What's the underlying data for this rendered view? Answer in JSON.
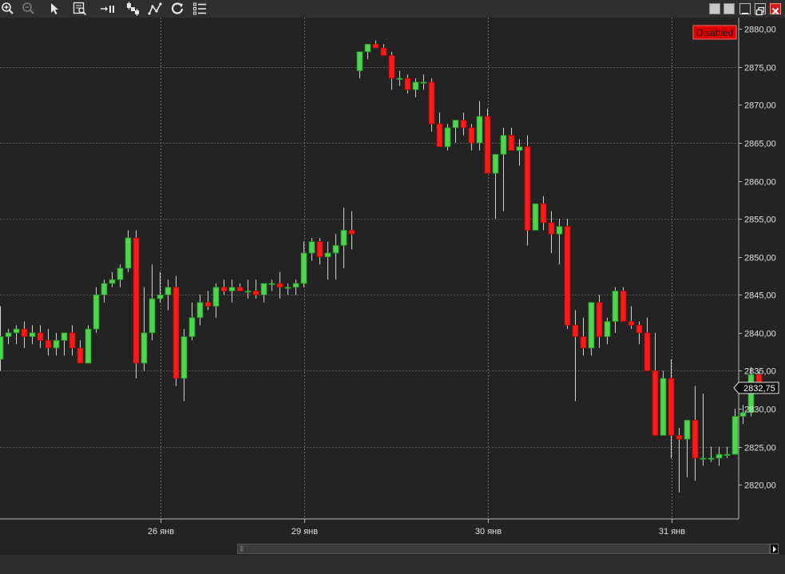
{
  "toolbar": {
    "tools": [
      {
        "name": "zoom-in-icon"
      },
      {
        "name": "zoom-out-icon"
      },
      {
        "name": "cursor-arrow-icon"
      },
      {
        "name": "magnify-data-box-icon"
      },
      {
        "name": "bar-spacing-icon"
      },
      {
        "name": "chart-type-icon"
      },
      {
        "name": "drawing-tools-icon"
      },
      {
        "name": "refresh-icon"
      },
      {
        "name": "list-icon"
      }
    ],
    "window_buttons": [
      "tile-button",
      "tile-button-2",
      "minimize-button",
      "restore-button",
      "close-button"
    ]
  },
  "status_badge": "Disabled",
  "current_price_label": "2832,75",
  "colors": {
    "background": "#232323",
    "up": "#2fb62f",
    "up_fill": "#4ed64e",
    "down": "#ff1a1a",
    "wick": "#d0d0d0",
    "grid": "#5a5a5a",
    "badge": "#e00000"
  },
  "chart_data": {
    "type": "candlestick",
    "y_ticks": [
      "2880,00",
      "2875,00",
      "2870,00",
      "2865,00",
      "2860,00",
      "2855,00",
      "2850,00",
      "2845,00",
      "2840,00",
      "2835,00",
      "2830,00",
      "2825,00",
      "2820,00"
    ],
    "ylim": [
      2815.5,
      2881.5
    ],
    "x_labels": [
      {
        "label": "26 янв",
        "index": 20.2
      },
      {
        "label": "29 янв",
        "index": 38.2
      },
      {
        "label": "30 янв",
        "index": 61.2
      },
      {
        "label": "31 янв",
        "index": 84.2
      }
    ],
    "session_breaks": [
      20.1,
      38.1,
      61.1,
      84.1
    ],
    "current_price": 2832.75,
    "candles": [
      [
        2836.5,
        2843.5,
        2835,
        2839.5
      ],
      [
        2839.5,
        2840.5,
        2838.5,
        2840
      ],
      [
        2840,
        2841,
        2838.5,
        2840.5
      ],
      [
        2840.5,
        2841.5,
        2838,
        2839.5
      ],
      [
        2839.5,
        2841,
        2838.5,
        2840
      ],
      [
        2840,
        2841,
        2838,
        2839
      ],
      [
        2839,
        2840.5,
        2837,
        2838
      ],
      [
        2838,
        2840,
        2837,
        2839
      ],
      [
        2839,
        2840,
        2837,
        2840
      ],
      [
        2840,
        2841,
        2837,
        2838
      ],
      [
        2838,
        2839,
        2836,
        2836
      ],
      [
        2836,
        2841,
        2836,
        2840.5
      ],
      [
        2840.5,
        2846,
        2840,
        2845
      ],
      [
        2845,
        2847,
        2844,
        2846.5
      ],
      [
        2846.5,
        2848,
        2846,
        2847
      ],
      [
        2847,
        2849,
        2846,
        2848.5
      ],
      [
        2848.5,
        2853.5,
        2848,
        2852.5
      ],
      [
        2852.5,
        2853.5,
        2834,
        2836
      ],
      [
        2836,
        2846,
        2835,
        2840
      ],
      [
        2840,
        2849,
        2839,
        2844.5
      ],
      [
        2844.5,
        2848,
        2844,
        2845
      ],
      [
        2845,
        2847,
        2843,
        2846
      ],
      [
        2846,
        2847.5,
        2833,
        2834
      ],
      [
        2834,
        2840.5,
        2831,
        2839.5
      ],
      [
        2839.5,
        2844,
        2839,
        2842
      ],
      [
        2842,
        2845,
        2841,
        2844
      ],
      [
        2844,
        2845.5,
        2843,
        2843.5
      ],
      [
        2843.5,
        2846.5,
        2842,
        2846
      ],
      [
        2846,
        2847,
        2845,
        2845.5
      ],
      [
        2845.5,
        2847,
        2844,
        2846
      ],
      [
        2846,
        2846.5,
        2845.5,
        2845.5
      ],
      [
        2845.5,
        2847,
        2844.5,
        2845.5
      ],
      [
        2845.5,
        2847,
        2844.5,
        2845
      ],
      [
        2845,
        2846.5,
        2844,
        2846.5
      ],
      [
        2846.5,
        2847,
        2845.5,
        2846.5
      ],
      [
        2846.5,
        2848,
        2844.5,
        2846
      ],
      [
        2846,
        2846.5,
        2845,
        2846
      ],
      [
        2846,
        2847,
        2845,
        2846.5
      ],
      [
        2846.5,
        2852,
        2846,
        2850.5
      ],
      [
        2850.5,
        2852.5,
        2849.5,
        2852
      ],
      [
        2852,
        2852.5,
        2849,
        2850
      ],
      [
        2850,
        2852,
        2847,
        2850.5
      ],
      [
        2850.5,
        2853,
        2847,
        2851.5
      ],
      [
        2851.5,
        2856.5,
        2848.5,
        2853.5
      ],
      [
        2853.5,
        2856,
        2851,
        2853
      ],
      [
        2874.5,
        2877,
        2873.5,
        2877
      ],
      [
        2877,
        2878,
        2876,
        2878
      ],
      [
        2878,
        2878.5,
        2877.5,
        2877.5
      ],
      [
        2877.5,
        2878,
        2876.5,
        2876.5
      ],
      [
        2876.5,
        2877,
        2872,
        2873.5
      ],
      [
        2873.5,
        2874.5,
        2872.5,
        2873.5
      ],
      [
        2873.5,
        2874,
        2871.5,
        2872
      ],
      [
        2872,
        2873.5,
        2871,
        2873
      ],
      [
        2873,
        2874,
        2872,
        2873
      ],
      [
        2873,
        2873.5,
        2866.5,
        2867.5
      ],
      [
        2867.5,
        2869,
        2864.5,
        2864.5
      ],
      [
        2864.5,
        2867.5,
        2864,
        2867
      ],
      [
        2867,
        2868,
        2865,
        2868
      ],
      [
        2868,
        2869,
        2866,
        2867
      ],
      [
        2867,
        2867.5,
        2864,
        2865
      ],
      [
        2865,
        2870.5,
        2864,
        2868.5
      ],
      [
        2868.5,
        2869.5,
        2861,
        2861
      ],
      [
        2861,
        2863.5,
        2855,
        2863.5
      ],
      [
        2863.5,
        2867,
        2856,
        2866
      ],
      [
        2866,
        2867,
        2864,
        2864
      ],
      [
        2864,
        2865.5,
        2862,
        2864.5
      ],
      [
        2864.5,
        2866,
        2851.5,
        2853.5
      ],
      [
        2853.5,
        2857,
        2853.5,
        2857
      ],
      [
        2857,
        2858,
        2853.5,
        2854.5
      ],
      [
        2854.5,
        2856,
        2850.5,
        2853
      ],
      [
        2853,
        2855,
        2849,
        2854
      ],
      [
        2854,
        2855,
        2840.5,
        2841
      ],
      [
        2841,
        2843,
        2831,
        2839.5
      ],
      [
        2839.5,
        2842,
        2837,
        2838
      ],
      [
        2838,
        2844,
        2837,
        2844
      ],
      [
        2844,
        2845,
        2838,
        2839.5
      ],
      [
        2839.5,
        2842,
        2838.5,
        2841.5
      ],
      [
        2841.5,
        2846,
        2840,
        2845.5
      ],
      [
        2845.5,
        2846,
        2841.5,
        2841.5
      ],
      [
        2841.5,
        2843.5,
        2840.5,
        2841
      ],
      [
        2841,
        2841.5,
        2838.5,
        2840
      ],
      [
        2840,
        2842,
        2835.5,
        2835
      ],
      [
        2835,
        2840,
        2834,
        2826.5
      ],
      [
        2826.5,
        2835,
        2826.5,
        2834
      ],
      [
        2834,
        2836.5,
        2823.5,
        2826.5
      ],
      [
        2826.5,
        2827.5,
        2819,
        2826
      ],
      [
        2826,
        2828.5,
        2821,
        2828.5
      ],
      [
        2828.5,
        2833,
        2820.5,
        2823.5
      ],
      [
        2823.5,
        2832,
        2822.5,
        2823.5
      ],
      [
        2823.5,
        2825,
        2823,
        2823.5
      ],
      [
        2823.5,
        2825,
        2822.5,
        2824
      ],
      [
        2824,
        2825,
        2823.5,
        2824
      ],
      [
        2824,
        2830,
        2824,
        2829
      ],
      [
        2829,
        2830.5,
        2828,
        2829.5
      ],
      [
        2829.5,
        2835.5,
        2829,
        2834.5
      ],
      [
        2834.5,
        2835,
        2832,
        2832.75
      ]
    ]
  }
}
